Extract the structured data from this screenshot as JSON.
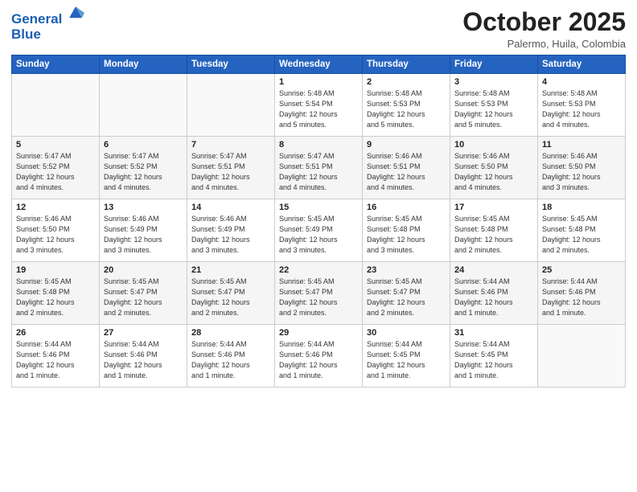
{
  "header": {
    "logo_line1": "General",
    "logo_line2": "Blue",
    "month_year": "October 2025",
    "location": "Palermo, Huila, Colombia"
  },
  "weekdays": [
    "Sunday",
    "Monday",
    "Tuesday",
    "Wednesday",
    "Thursday",
    "Friday",
    "Saturday"
  ],
  "weeks": [
    [
      {
        "day": "",
        "info": ""
      },
      {
        "day": "",
        "info": ""
      },
      {
        "day": "",
        "info": ""
      },
      {
        "day": "1",
        "info": "Sunrise: 5:48 AM\nSunset: 5:54 PM\nDaylight: 12 hours\nand 5 minutes."
      },
      {
        "day": "2",
        "info": "Sunrise: 5:48 AM\nSunset: 5:53 PM\nDaylight: 12 hours\nand 5 minutes."
      },
      {
        "day": "3",
        "info": "Sunrise: 5:48 AM\nSunset: 5:53 PM\nDaylight: 12 hours\nand 5 minutes."
      },
      {
        "day": "4",
        "info": "Sunrise: 5:48 AM\nSunset: 5:53 PM\nDaylight: 12 hours\nand 4 minutes."
      }
    ],
    [
      {
        "day": "5",
        "info": "Sunrise: 5:47 AM\nSunset: 5:52 PM\nDaylight: 12 hours\nand 4 minutes."
      },
      {
        "day": "6",
        "info": "Sunrise: 5:47 AM\nSunset: 5:52 PM\nDaylight: 12 hours\nand 4 minutes."
      },
      {
        "day": "7",
        "info": "Sunrise: 5:47 AM\nSunset: 5:51 PM\nDaylight: 12 hours\nand 4 minutes."
      },
      {
        "day": "8",
        "info": "Sunrise: 5:47 AM\nSunset: 5:51 PM\nDaylight: 12 hours\nand 4 minutes."
      },
      {
        "day": "9",
        "info": "Sunrise: 5:46 AM\nSunset: 5:51 PM\nDaylight: 12 hours\nand 4 minutes."
      },
      {
        "day": "10",
        "info": "Sunrise: 5:46 AM\nSunset: 5:50 PM\nDaylight: 12 hours\nand 4 minutes."
      },
      {
        "day": "11",
        "info": "Sunrise: 5:46 AM\nSunset: 5:50 PM\nDaylight: 12 hours\nand 3 minutes."
      }
    ],
    [
      {
        "day": "12",
        "info": "Sunrise: 5:46 AM\nSunset: 5:50 PM\nDaylight: 12 hours\nand 3 minutes."
      },
      {
        "day": "13",
        "info": "Sunrise: 5:46 AM\nSunset: 5:49 PM\nDaylight: 12 hours\nand 3 minutes."
      },
      {
        "day": "14",
        "info": "Sunrise: 5:46 AM\nSunset: 5:49 PM\nDaylight: 12 hours\nand 3 minutes."
      },
      {
        "day": "15",
        "info": "Sunrise: 5:45 AM\nSunset: 5:49 PM\nDaylight: 12 hours\nand 3 minutes."
      },
      {
        "day": "16",
        "info": "Sunrise: 5:45 AM\nSunset: 5:48 PM\nDaylight: 12 hours\nand 3 minutes."
      },
      {
        "day": "17",
        "info": "Sunrise: 5:45 AM\nSunset: 5:48 PM\nDaylight: 12 hours\nand 2 minutes."
      },
      {
        "day": "18",
        "info": "Sunrise: 5:45 AM\nSunset: 5:48 PM\nDaylight: 12 hours\nand 2 minutes."
      }
    ],
    [
      {
        "day": "19",
        "info": "Sunrise: 5:45 AM\nSunset: 5:48 PM\nDaylight: 12 hours\nand 2 minutes."
      },
      {
        "day": "20",
        "info": "Sunrise: 5:45 AM\nSunset: 5:47 PM\nDaylight: 12 hours\nand 2 minutes."
      },
      {
        "day": "21",
        "info": "Sunrise: 5:45 AM\nSunset: 5:47 PM\nDaylight: 12 hours\nand 2 minutes."
      },
      {
        "day": "22",
        "info": "Sunrise: 5:45 AM\nSunset: 5:47 PM\nDaylight: 12 hours\nand 2 minutes."
      },
      {
        "day": "23",
        "info": "Sunrise: 5:45 AM\nSunset: 5:47 PM\nDaylight: 12 hours\nand 2 minutes."
      },
      {
        "day": "24",
        "info": "Sunrise: 5:44 AM\nSunset: 5:46 PM\nDaylight: 12 hours\nand 1 minute."
      },
      {
        "day": "25",
        "info": "Sunrise: 5:44 AM\nSunset: 5:46 PM\nDaylight: 12 hours\nand 1 minute."
      }
    ],
    [
      {
        "day": "26",
        "info": "Sunrise: 5:44 AM\nSunset: 5:46 PM\nDaylight: 12 hours\nand 1 minute."
      },
      {
        "day": "27",
        "info": "Sunrise: 5:44 AM\nSunset: 5:46 PM\nDaylight: 12 hours\nand 1 minute."
      },
      {
        "day": "28",
        "info": "Sunrise: 5:44 AM\nSunset: 5:46 PM\nDaylight: 12 hours\nand 1 minute."
      },
      {
        "day": "29",
        "info": "Sunrise: 5:44 AM\nSunset: 5:46 PM\nDaylight: 12 hours\nand 1 minute."
      },
      {
        "day": "30",
        "info": "Sunrise: 5:44 AM\nSunset: 5:45 PM\nDaylight: 12 hours\nand 1 minute."
      },
      {
        "day": "31",
        "info": "Sunrise: 5:44 AM\nSunset: 5:45 PM\nDaylight: 12 hours\nand 1 minute."
      },
      {
        "day": "",
        "info": ""
      }
    ]
  ]
}
